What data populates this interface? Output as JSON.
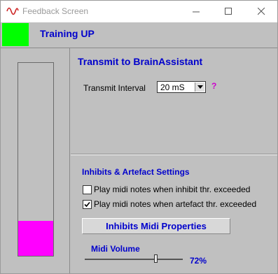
{
  "window": {
    "title": "Feedback Screen"
  },
  "titlebar": {
    "minimize_icon": "minimize-icon",
    "maximize_icon": "maximize-icon",
    "close_icon": "close-icon"
  },
  "header": {
    "status_color": "#00ff00",
    "title": "Training UP"
  },
  "meter": {
    "level": 0.18,
    "fill_color": "#ff00ff"
  },
  "transmit": {
    "title": "Transmit to BrainAssistant",
    "interval_label": "Transmit Interval",
    "interval_value": "20 mS",
    "help": "?"
  },
  "inhibits": {
    "title": "Inhibits & Artefact Settings",
    "options": [
      {
        "label": "Play midi notes when inhibit thr. exceeded",
        "checked": false
      },
      {
        "label": "Play midi notes when artefact thr. exceeded",
        "checked": true
      }
    ],
    "properties_button": "Inhibits Midi Properties"
  },
  "midi_volume": {
    "title": "Midi Volume",
    "value": 72,
    "display": "72%"
  }
}
